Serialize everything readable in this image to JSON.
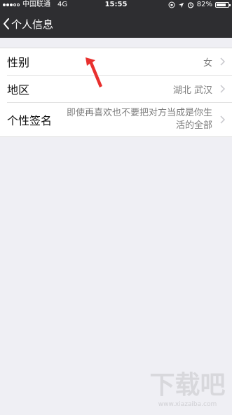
{
  "status_bar": {
    "carrier": "中国联通",
    "network": "4G",
    "time": "15:55",
    "battery": "82%",
    "battery_level": 0.82
  },
  "nav": {
    "back_label": "个人信息"
  },
  "rows": [
    {
      "label": "性别",
      "value": "女"
    },
    {
      "label": "地区",
      "value": "湖北 武汉"
    },
    {
      "label": "个性签名",
      "value": "即使再喜欢也不要把对方当成是你生活的全部"
    }
  ],
  "watermark": {
    "text": "下载吧",
    "url": "www.xiazaiba.com"
  },
  "colors": {
    "nav_bg": "#2e2e31",
    "page_bg": "#efeff4",
    "arrow": "#e8302e"
  }
}
